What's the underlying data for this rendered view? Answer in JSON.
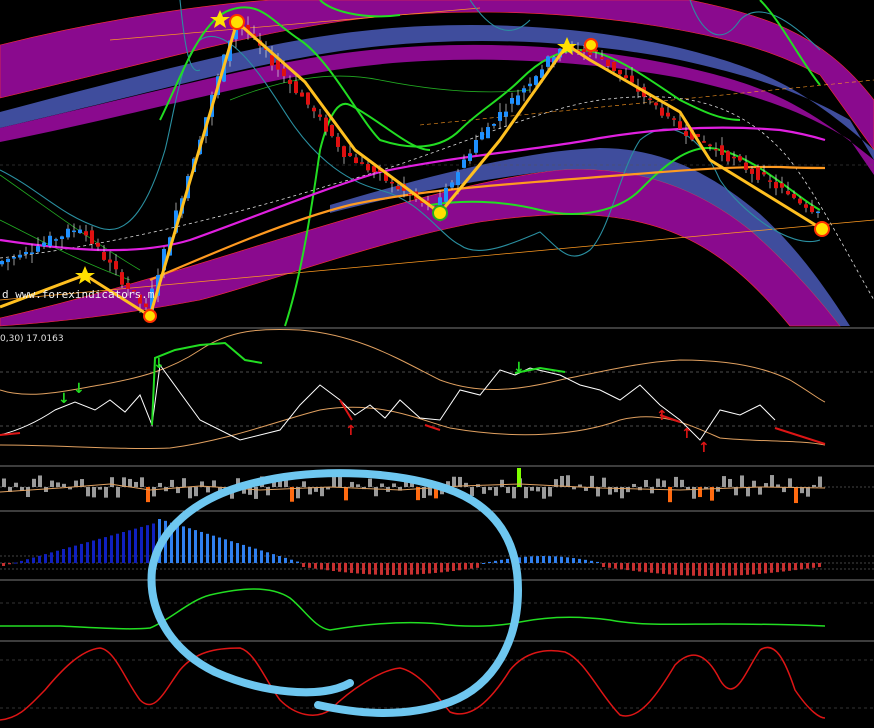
{
  "chart": {
    "watermark": "d www.forexindicators.m",
    "subwindow_label": "0,30) 17.0163"
  },
  "colors": {
    "background": "#000000",
    "band_purple": "#8a0a8e",
    "band_slate": "#4a5ab8",
    "bull_candle": "#1e90ff",
    "bear_candle": "#e01010",
    "zigzag": "#ffc020",
    "green_line": "#22dd22",
    "magenta_ma": "#e020e0",
    "orange_ma": "#ff9a20",
    "teal_line": "#2a8fa0",
    "annotation_circle": "#6ec7f0",
    "histogram_blue_dark": "#1020c0",
    "histogram_blue_light": "#3080f0",
    "histogram_red": "#c83030",
    "volume_gray": "#9a9a9a",
    "volume_orange": "#ff6a10",
    "oscillator_red": "#dd1515",
    "separator": "#7a7a7a"
  },
  "chart_data": {
    "type": "line",
    "panels": [
      {
        "name": "price",
        "series": [
          "candles",
          "zigzag",
          "channel bands",
          "moving averages"
        ]
      },
      {
        "name": "oscillator",
        "series": [
          "green signal",
          "white line",
          "orange line"
        ]
      },
      {
        "name": "volume-bars",
        "series": [
          "gray",
          "orange"
        ]
      },
      {
        "name": "histogram",
        "series": [
          "blue",
          "red"
        ]
      },
      {
        "name": "green-line",
        "series": [
          "green"
        ]
      },
      {
        "name": "red-line",
        "series": [
          "red"
        ]
      }
    ],
    "zigzag_points": [
      {
        "bar": 0,
        "price": 0.18
      },
      {
        "bar": 14,
        "price": 0.3
      },
      {
        "bar": 25,
        "price": 0.03
      },
      {
        "bar": 40,
        "price": 0.97
      },
      {
        "bar": 51,
        "price": 0.72
      },
      {
        "bar": 58,
        "price": 0.54
      },
      {
        "bar": 73,
        "price": 0.35
      },
      {
        "bar": 80,
        "price": 0.58
      },
      {
        "bar": 94,
        "price": 0.88
      },
      {
        "bar": 100,
        "price": 0.86
      },
      {
        "bar": 114,
        "price": 0.62
      },
      {
        "bar": 120,
        "price": 0.55
      },
      {
        "bar": 136,
        "price": 0.36
      }
    ]
  }
}
